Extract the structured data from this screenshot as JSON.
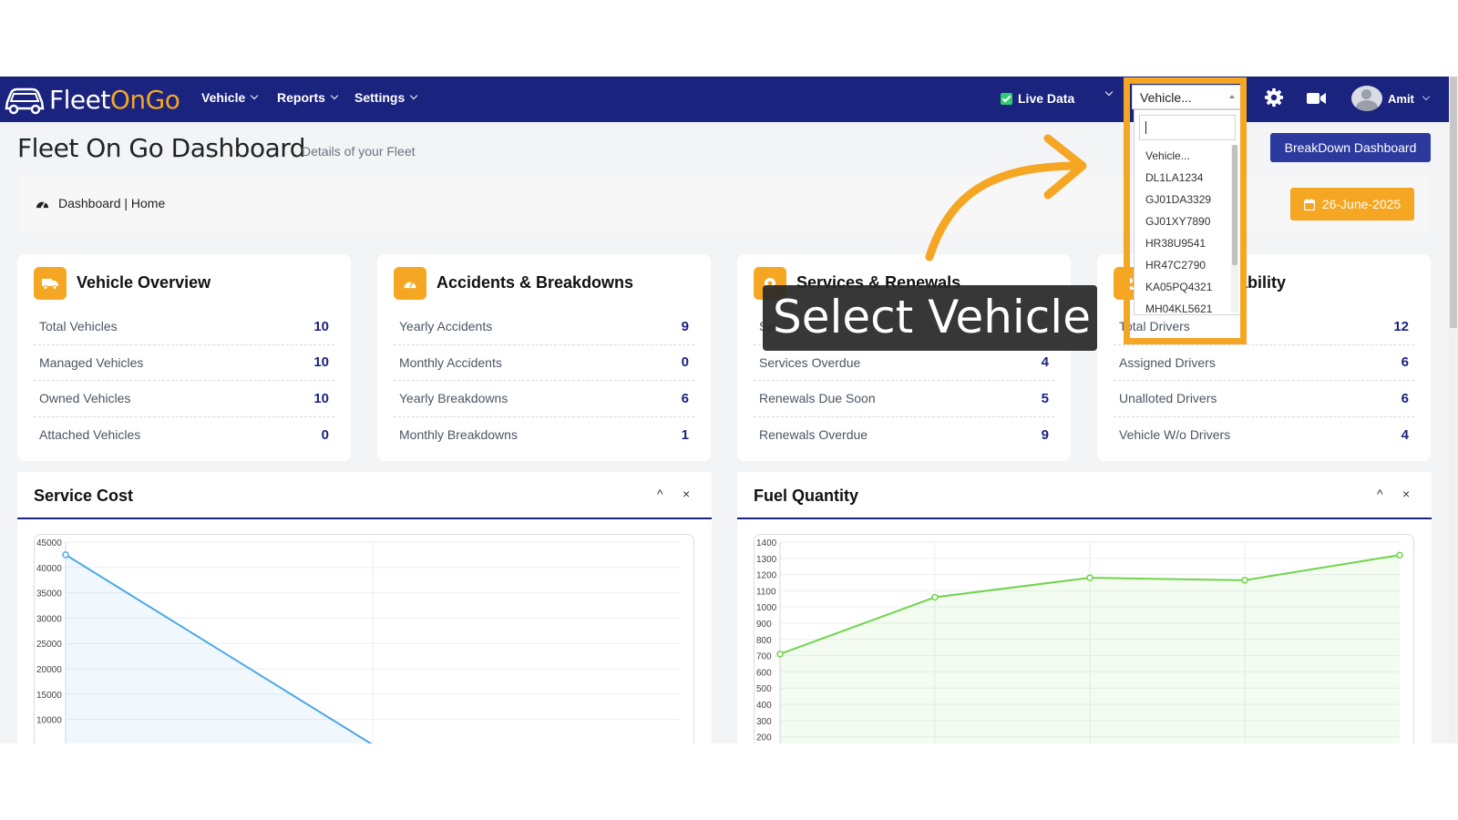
{
  "brand": {
    "prefix": "Fleet",
    "highlight": "OnGo"
  },
  "nav": {
    "menus": [
      {
        "label": "Vehicle"
      },
      {
        "label": "Reports"
      },
      {
        "label": "Settings"
      }
    ],
    "live_data_label": "Live Data",
    "live_data_checked": true,
    "vehicle_select_value": "Vehicle...",
    "user_name": "Amit"
  },
  "vehicle_dropdown": {
    "search_value": "",
    "options": [
      "Vehicle...",
      "DL1LA1234",
      "GJ01DA3329",
      "GJ01XY7890",
      "HR38U9541",
      "HR47C2790",
      "KA05PQ4321",
      "MH04KL5621"
    ]
  },
  "header": {
    "title": "Fleet On Go Dashboard",
    "subtitle": "Details of your Fleet",
    "breakdown_button": "BreakDown Dashboard",
    "breadcrumb": "Dashboard | Home",
    "date": "26-June-2025"
  },
  "cards": [
    {
      "title": "Vehicle Overview",
      "rows": [
        {
          "label": "Total Vehicles",
          "value": "10"
        },
        {
          "label": "Managed Vehicles",
          "value": "10"
        },
        {
          "label": "Owned Vehicles",
          "value": "10"
        },
        {
          "label": "Attached Vehicles",
          "value": "0"
        }
      ]
    },
    {
      "title": "Accidents & Breakdowns",
      "rows": [
        {
          "label": "Yearly Accidents",
          "value": "9"
        },
        {
          "label": "Monthly Accidents",
          "value": "0"
        },
        {
          "label": "Yearly Breakdowns",
          "value": "6"
        },
        {
          "label": "Monthly Breakdowns",
          "value": "1"
        }
      ]
    },
    {
      "title": "Services & Renewals",
      "rows": [
        {
          "label": "Se",
          "value": ""
        },
        {
          "label": "Services Overdue",
          "value": "4"
        },
        {
          "label": "Renewals Due Soon",
          "value": "5"
        },
        {
          "label": "Renewals Overdue",
          "value": "9"
        }
      ]
    },
    {
      "title": "ability",
      "rows": [
        {
          "label": "Total Drivers",
          "value": "12"
        },
        {
          "label": "Assigned Drivers",
          "value": "6"
        },
        {
          "label": "Unalloted Drivers",
          "value": "6"
        },
        {
          "label": "Vehicle W/o Drivers",
          "value": "4"
        }
      ]
    }
  ],
  "panels": {
    "service_cost_title": "Service Cost",
    "fuel_quantity_title": "Fuel Quantity",
    "collapse_symbol": "^",
    "close_symbol": "×"
  },
  "overlay": {
    "callout_text": "Select Vehicle",
    "frame_color": "#f5a623"
  },
  "colors": {
    "navbar": "#1a237e",
    "accent": "#f5a623",
    "button": "#2c3a9e",
    "service_line": "#4aa8e8",
    "fuel_line": "#6fd44a"
  },
  "icons": {
    "brand": "car-icon",
    "settings": "gear-icon",
    "camera": "video-camera-icon",
    "breadcrumb": "speedometer-icon",
    "date": "calendar-icon"
  },
  "chart_data": [
    {
      "type": "area",
      "title": "Service Cost",
      "yticks": [
        "45000",
        "40000",
        "35000",
        "30000",
        "25000",
        "20000",
        "15000",
        "10000"
      ],
      "ylim": [
        5000,
        45000
      ],
      "series": [
        {
          "x": [
            0,
            1
          ],
          "values": [
            42500,
            5000
          ]
        }
      ]
    },
    {
      "type": "area",
      "title": "Fuel Quantity",
      "yticks": [
        "1400",
        "1300",
        "1200",
        "1100",
        "1000",
        "900",
        "800",
        "700",
        "600",
        "500",
        "400",
        "300",
        "200"
      ],
      "ylim": [
        200,
        1400
      ],
      "series": [
        {
          "x": [
            0,
            1,
            2,
            3,
            4
          ],
          "values": [
            710,
            1060,
            1180,
            1165,
            1320
          ]
        }
      ]
    }
  ]
}
